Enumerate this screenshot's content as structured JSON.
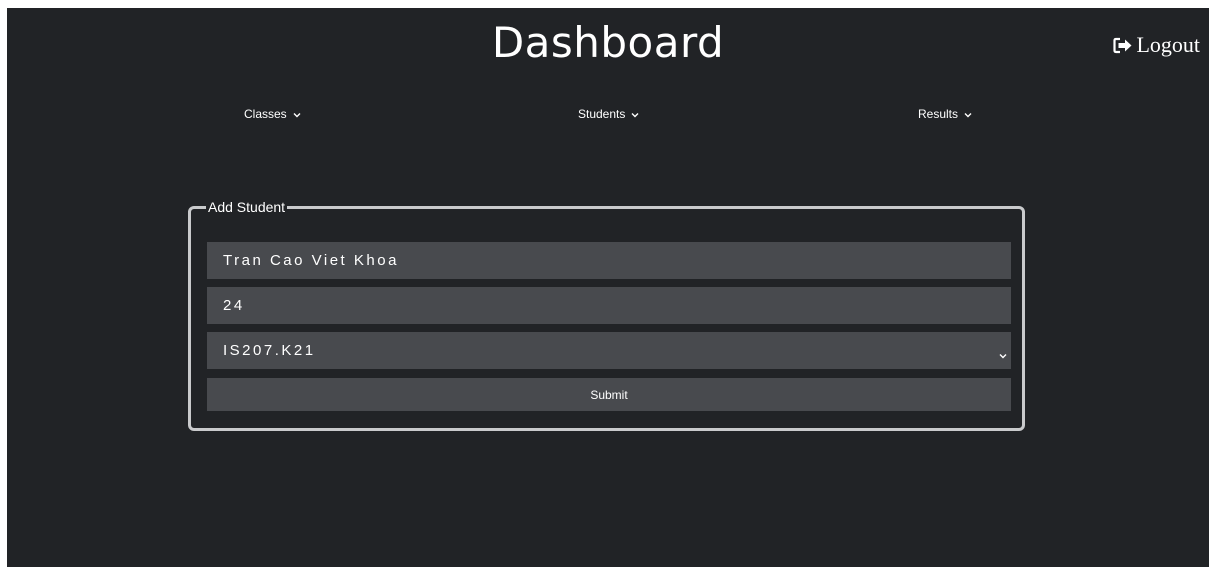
{
  "header": {
    "title": "Dashboard",
    "logout_label": "Logout"
  },
  "nav": {
    "items": [
      {
        "label": "Classes",
        "icon": "chevron-down-icon"
      },
      {
        "label": "Students",
        "icon": "chevron-down-icon"
      },
      {
        "label": "Results",
        "icon": "chevron-down-icon"
      }
    ]
  },
  "form": {
    "legend": "Add Student",
    "name_value": "Tran Cao Viet Khoa",
    "age_value": "24",
    "class_selected": "IS207.K21",
    "submit_label": "Submit"
  },
  "colors": {
    "background": "#212326",
    "field": "#484a4e",
    "border": "#c9cacc",
    "text": "#ffffff"
  }
}
